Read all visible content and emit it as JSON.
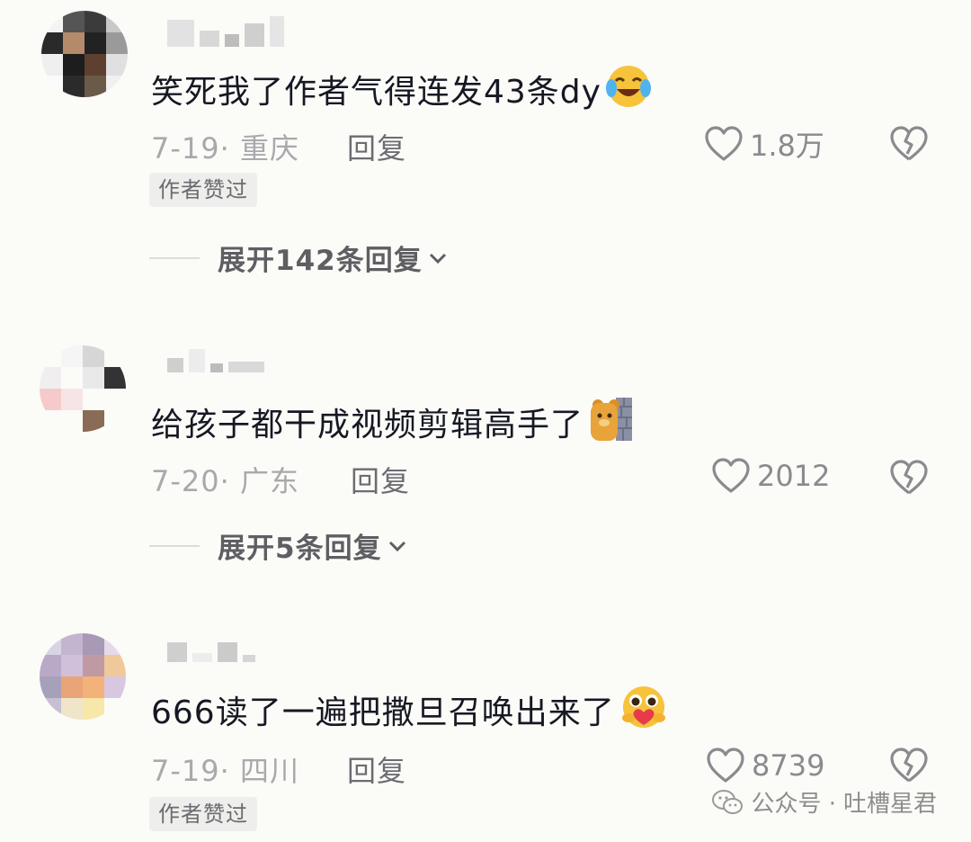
{
  "comments": [
    {
      "text": "笑死我了作者气得连发43条dy",
      "emoji": "crying-laughing-emoji",
      "date": "7-19",
      "sep": "·",
      "location": "重庆",
      "reply_label": "回复",
      "likes": "1.8万",
      "badge": "作者赞过",
      "expand_label": "展开142条回复"
    },
    {
      "text": "给孩子都干成视频剪辑高手了",
      "emoji": "peeking-bear-emoji",
      "date": "7-20",
      "sep": "·",
      "location": "广东",
      "reply_label": "回复",
      "likes": "2012",
      "expand_label": "展开5条回复"
    },
    {
      "text": "666读了一遍把撒旦召唤出来了",
      "emoji": "heart-hug-emoji",
      "date": "7-19",
      "sep": "·",
      "location": "四川",
      "reply_label": "回复",
      "likes": "8739",
      "badge": "作者赞过"
    }
  ],
  "watermark": {
    "prefix": "公众号 ·",
    "name": "吐槽星君"
  },
  "colors": {
    "background": "#fbfbf8",
    "text": "#161823",
    "meta": "#a9a9ad",
    "icon": "#8a8a8f"
  }
}
